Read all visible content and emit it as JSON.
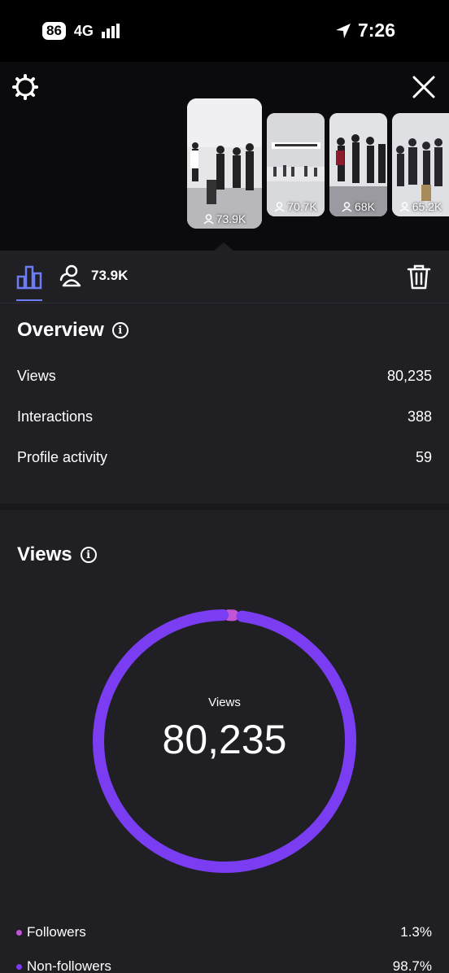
{
  "status_bar": {
    "battery": "86",
    "network": "4G",
    "time": "7:26"
  },
  "carousel": [
    {
      "reach": "73.9K",
      "active": true
    },
    {
      "reach": "70.7K",
      "active": false
    },
    {
      "reach": "68K",
      "active": false
    },
    {
      "reach": "65.2K",
      "active": false
    }
  ],
  "tabs": {
    "reach_value": "73.9K"
  },
  "overview": {
    "title": "Overview",
    "rows": [
      {
        "label": "Views",
        "value": "80,235"
      },
      {
        "label": "Interactions",
        "value": "388"
      },
      {
        "label": "Profile activity",
        "value": "59"
      }
    ]
  },
  "views": {
    "title": "Views",
    "center_label": "Views",
    "center_value": "80,235",
    "legend": [
      {
        "label": "Followers",
        "value": "1.3%",
        "fraction": 0.013,
        "color": "#c254d6"
      },
      {
        "label": "Non-followers",
        "value": "98.7%",
        "fraction": 0.987,
        "color": "#7b3df2"
      }
    ]
  },
  "colors": {
    "accent": "#6d7cf5",
    "panel": "#1f1f24"
  }
}
